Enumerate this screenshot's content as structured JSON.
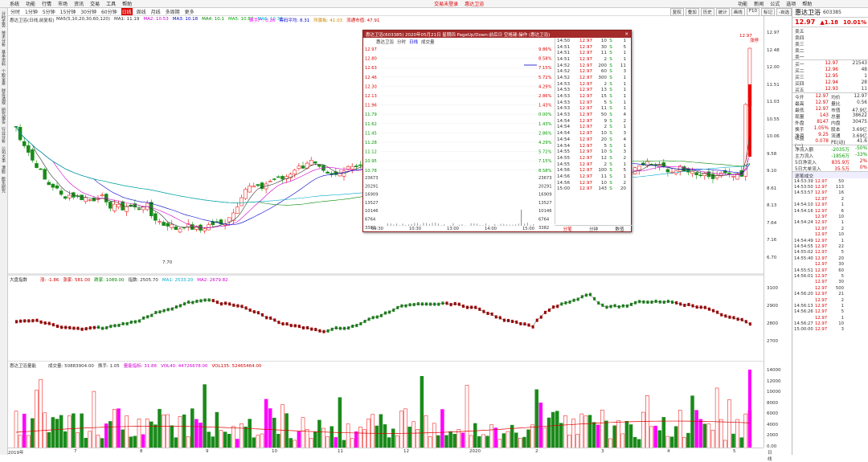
{
  "menubar": {
    "items": [
      "系统",
      "功能",
      "行情",
      "市场",
      "资讯",
      "交易",
      "工具",
      "帮助"
    ],
    "center": "交易未登录",
    "center2": "惠达卫浴",
    "right": [
      "功能",
      "新闻",
      "公式",
      "选项",
      "帮助"
    ]
  },
  "toolbar": {
    "periods": [
      "分时",
      "1分钟",
      "5分钟",
      "15分钟",
      "30分钟",
      "60分钟",
      "日线",
      "周线",
      "月线",
      "多周期",
      "更多"
    ],
    "active_index": 6,
    "right": [
      "复权",
      "叠加",
      "历史",
      "统计",
      "画线",
      "F10",
      "标记",
      "-自选"
    ]
  },
  "leftside": {
    "tabs": [
      "分时走势",
      "技术分析",
      "基本资料",
      "个股全景",
      "财务透视",
      "研究报告",
      "行业分析",
      "公司大事",
      "港股",
      "股东研究"
    ]
  },
  "chart1": {
    "legend_title": "惠达卫浴(日线,前复权)",
    "ma_legend": [
      {
        "label": "MA5(5,10,20,30,60,120)",
        "color": "#333333"
      },
      {
        "label": "MA1: 11.19",
        "color": "#333333"
      },
      {
        "label": "MA2: 10.53",
        "color": "#d000d0"
      },
      {
        "label": "MA3: 10.18",
        "color": "#0000cc"
      },
      {
        "label": "MA4: 10.1",
        "color": "#008800"
      },
      {
        "label": "MA5: 10.87",
        "color": "#00aa00"
      },
      {
        "label": "MA6: 10.37",
        "color": "#00bbcc"
      }
    ],
    "extra_legend": [
      {
        "label": "换手户: 0.26",
        "color": "#ff00ff"
      },
      {
        "label": "筹码平均: 8.31",
        "color": "#0000cc"
      },
      {
        "label": "所属板: 41.03",
        "color": "#cc8800"
      },
      {
        "label": "流通市值: 47.91",
        "color": "#d00000"
      }
    ],
    "low_label": "7.70",
    "high_label": "12.97",
    "high_tag": "涨停"
  },
  "chart2": {
    "legend": "大盘指数",
    "vals": [
      {
        "label": "涨: -1.86",
        "color": "#d00000"
      },
      {
        "label": "涨家: 581.00",
        "color": "#d00000"
      },
      {
        "label": "跌家: 1089.00",
        "color": "#008800"
      },
      {
        "label": "指数: 2505.70",
        "color": "#333333"
      },
      {
        "label": "MA1: 2533.20",
        "color": "#00aacc"
      },
      {
        "label": "MA2: 2679.82",
        "color": "#d000d0"
      }
    ],
    "tags": [
      "买",
      "卖"
    ]
  },
  "chart3": {
    "legend": "惠达卫浴量能",
    "vals": [
      {
        "label": "成交量: 50883904.00",
        "color": "#333333"
      },
      {
        "label": "换手: 1.05",
        "color": "#333333"
      },
      {
        "label": "量能指标: 31.86",
        "color": "#d000d0"
      },
      {
        "label": "VOL40: 44726678.00",
        "color": "#d000d0"
      },
      {
        "label": "VOL135: 52465464.00",
        "color": "#d00000"
      }
    ]
  },
  "axis1": {
    "labels": [
      "12.97",
      "12.48",
      "12.00",
      "11.51",
      "11.03",
      "10.55",
      "10.06",
      "9.58",
      "9.10",
      "8.61",
      "8.13",
      "7.64",
      "7.16",
      "6.70"
    ],
    "axis2": [
      "3100",
      "2900",
      "2800",
      "2700"
    ],
    "axis3": [
      "14000",
      "12000",
      "10000",
      "8000",
      "6000",
      "4000",
      "2000",
      "0.00"
    ]
  },
  "dateaxis": {
    "labels": [
      "2019年",
      "7",
      "8",
      "9",
      "10",
      "11",
      "12",
      "2020",
      "2",
      "3",
      "4",
      "5",
      "日线"
    ]
  },
  "right": {
    "title": "惠达卫浴",
    "code": "603385",
    "price": "12.97",
    "change": "▲1.18",
    "pct": "10.01%",
    "asks": [
      {
        "l": "卖五",
        "p": "",
        "v": ""
      },
      {
        "l": "卖四",
        "p": "",
        "v": ""
      },
      {
        "l": "卖三",
        "p": "",
        "v": ""
      },
      {
        "l": "卖二",
        "p": "",
        "v": ""
      },
      {
        "l": "卖一",
        "p": "",
        "v": ""
      }
    ],
    "bids": [
      {
        "l": "买一",
        "p": "12.97",
        "v": "21543"
      },
      {
        "l": "买二",
        "p": "12.96",
        "v": "48"
      },
      {
        "l": "买三",
        "p": "12.95",
        "v": "1"
      },
      {
        "l": "买四",
        "p": "12.94",
        "v": "28"
      },
      {
        "l": "买五",
        "p": "12.93",
        "v": "11"
      }
    ],
    "stats": [
      {
        "l": "今开",
        "v": "12.97",
        "l2": "均价",
        "v2": "12.97"
      },
      {
        "l": "最高",
        "v": "12.97",
        "l2": "量比",
        "v2": "0.56"
      },
      {
        "l": "最低",
        "v": "12.97",
        "l2": "市值",
        "v2": "47.9亿"
      },
      {
        "l": "现量",
        "v": "143",
        "l2": "总量",
        "v2": "38622"
      },
      {
        "l": "外盘",
        "v": "8147",
        "l2": "内盘",
        "v2": "30475"
      },
      {
        "l": "换手",
        "v": "1.05%",
        "l2": "股本",
        "v2": "3.69亿"
      },
      {
        "l": "净资",
        "v": "9.25",
        "l2": "流通",
        "v2": "3.69亿"
      },
      {
        "l": "收益(一)",
        "v": "0.078",
        "l2": "PE(动)",
        "v2": "41.6"
      }
    ],
    "flows": [
      {
        "l": "净流入额",
        "v": "-2035万",
        "p": "-50%"
      },
      {
        "l": "主力流入",
        "v": "-1856万",
        "p": "-33%"
      },
      {
        "l": "5日净流入",
        "v": "835.9万",
        "p": "2%"
      },
      {
        "l": "5日大单流入",
        "v": "35.5万",
        "p": "0%"
      }
    ],
    "tick_header": "逐笔成交",
    "ticks": [
      [
        "14:53:39",
        "12.97",
        "50"
      ],
      [
        "14:53:50",
        "12.97",
        "113"
      ],
      [
        "14:53:57",
        "12.97",
        "16"
      ],
      [
        "",
        "12.97",
        "2"
      ],
      [
        "14:54:10",
        "12.97",
        "1"
      ],
      [
        "14:54:16",
        "12.97",
        "6"
      ],
      [
        "",
        "12.97",
        "10"
      ],
      [
        "14:54:24",
        "12.97",
        "1"
      ],
      [
        "",
        "12.97",
        "2"
      ],
      [
        "",
        "12.97",
        "10"
      ],
      [
        "14:54:49",
        "12.97",
        "1"
      ],
      [
        "14:54:55",
        "12.97",
        "22"
      ],
      [
        "14:55:02",
        "12.97",
        "5"
      ],
      [
        "14:55:40",
        "12.97",
        "20"
      ],
      [
        "",
        "12.97",
        "30"
      ],
      [
        "14:55:51",
        "12.97",
        "60"
      ],
      [
        "14:56:01",
        "12.97",
        "5"
      ],
      [
        "",
        "12.97",
        "30"
      ],
      [
        "",
        "12.97",
        "500"
      ],
      [
        "14:56:20",
        "12.97",
        "21"
      ],
      [
        "",
        "12.97",
        "2"
      ],
      [
        "14:56:13",
        "12.97",
        "1"
      ],
      [
        "14:56:26",
        "12.97",
        "5"
      ],
      [
        "",
        "12.97",
        "1"
      ],
      [
        "14:56:27",
        "12.97",
        "10"
      ],
      [
        "15:00:00",
        "12.97",
        "3"
      ]
    ]
  },
  "popup": {
    "title": "惠达卫浴(603385) 2020年05月21日 星期四 PageUp/Down:前后日 空格键:操作 (惠达卫浴)",
    "tabs": [
      "惠达卫浴",
      "分时",
      "日线",
      "成交量"
    ],
    "left_prices": [
      "12.97",
      "12.80",
      "12.63",
      "12.46",
      "12.30",
      "12.13",
      "11.96",
      "11.79",
      "11.62",
      "11.45",
      "11.28",
      "11.12",
      "10.95",
      "10.78"
    ],
    "right_pcts": [
      "9.86%",
      "8.58%",
      "7.15%",
      "5.72%",
      "4.29%",
      "2.86%",
      "1.43%",
      "0.00%",
      "1.43%",
      "2.86%",
      "4.29%",
      "5.72%",
      "7.15%",
      "8.58%"
    ],
    "vol_labels": [
      "23673",
      "20291",
      "16909",
      "13527",
      "10146",
      "6764",
      "3382"
    ],
    "times": [
      "09:30",
      "10:30",
      "13:00",
      "14:00",
      "15:00"
    ],
    "ticks": [
      [
        "14:50",
        "12.97",
        "10",
        "S",
        "1"
      ],
      [
        "14:51",
        "12.97",
        "30",
        "S",
        "5"
      ],
      [
        "14:51",
        "12.97",
        "11",
        "S",
        "1"
      ],
      [
        "14:51",
        "12.97",
        "2",
        "S",
        "1"
      ],
      [
        "14:52",
        "12.97",
        "200",
        "S",
        "11"
      ],
      [
        "14:52",
        "12.97",
        "60",
        "S",
        "3"
      ],
      [
        "14:52",
        "12.97",
        "300",
        "S",
        "1"
      ],
      [
        "14:53",
        "12.97",
        "2",
        "S",
        "1"
      ],
      [
        "14:53",
        "12.97",
        "13",
        "S",
        "1"
      ],
      [
        "14:53",
        "12.97",
        "15",
        "S",
        "1"
      ],
      [
        "14:53",
        "12.97",
        "5",
        "S",
        "1"
      ],
      [
        "14:53",
        "12.97",
        "11",
        "S",
        "1"
      ],
      [
        "14:53",
        "12.97",
        "50",
        "S",
        "4"
      ],
      [
        "14:54",
        "12.97",
        "9",
        "S",
        "2"
      ],
      [
        "14:54",
        "12.97",
        "2",
        "S",
        "1"
      ],
      [
        "14:54",
        "12.97",
        "10",
        "S",
        "3"
      ],
      [
        "14:54",
        "12.97",
        "20",
        "S",
        "4"
      ],
      [
        "14:54",
        "12.97",
        "5",
        "S",
        "1"
      ],
      [
        "14:55",
        "12.97",
        "10",
        "S",
        "3"
      ],
      [
        "14:55",
        "12.97",
        "12",
        "S",
        "2"
      ],
      [
        "14:55",
        "12.97",
        "2",
        "S",
        "1"
      ],
      [
        "14:56",
        "12.97",
        "100",
        "S",
        "5"
      ],
      [
        "14:56",
        "12.97",
        "11",
        "S",
        "1"
      ],
      [
        "14:56",
        "12.97",
        "10",
        "S",
        "2"
      ],
      [
        "15:00",
        "12.97",
        "143",
        "S",
        "20"
      ]
    ],
    "buttons": [
      "分笔",
      "分钟",
      "数值"
    ]
  }
}
